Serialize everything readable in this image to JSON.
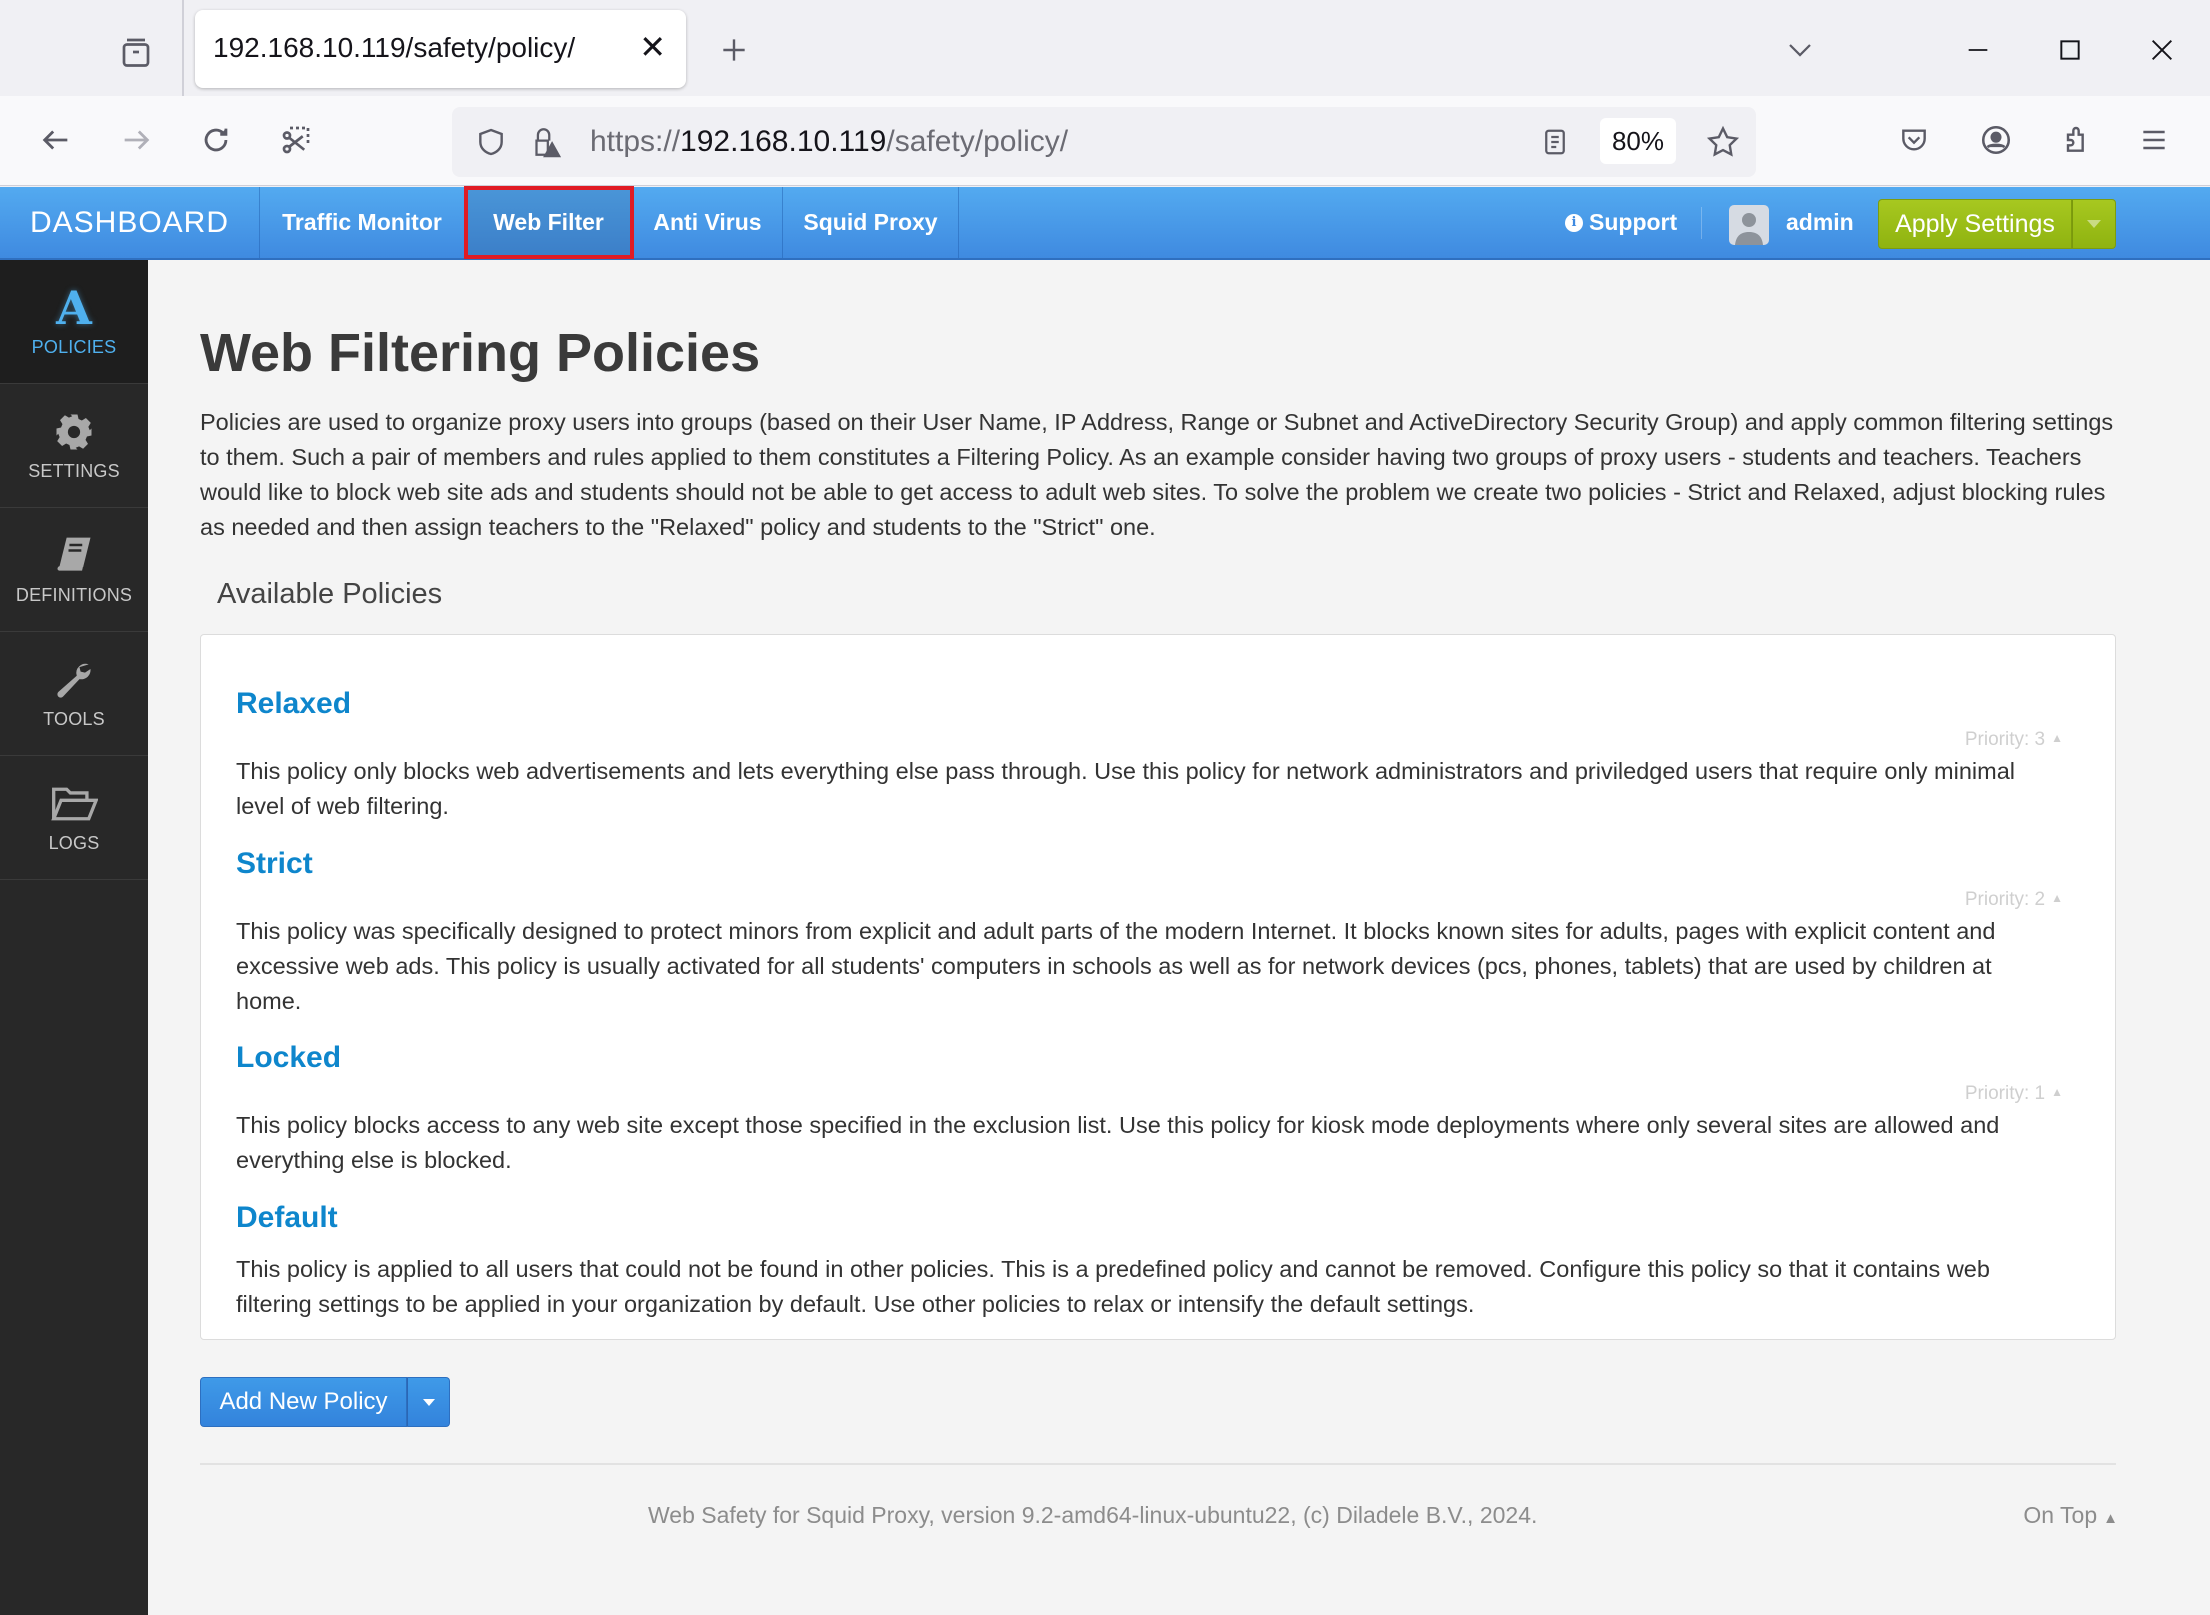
{
  "browser": {
    "tab_title": "192.168.10.119/safety/policy/",
    "url_scheme": "https://",
    "url_host": "192.168.10.119",
    "url_path": "/safety/policy/",
    "zoom_level": "80%",
    "icons": {
      "tab_overview": "tab-overview-icon",
      "close_tab": "close-icon",
      "new_tab": "plus-icon",
      "list_all_tabs": "chevron-down-icon",
      "minimize": "minimize-icon",
      "maximize": "maximize-icon",
      "close_window": "close-icon",
      "back": "arrow-left-icon",
      "forward": "arrow-right-icon",
      "reload": "reload-icon",
      "screenshot": "screenshot-icon",
      "shield": "shield-icon",
      "insecure_lock": "lock-warning-icon",
      "reader_view": "reader-view-icon",
      "bookmark": "star-icon",
      "pocket": "pocket-icon",
      "account": "account-icon",
      "extensions": "puzzle-icon",
      "menu": "hamburger-icon"
    }
  },
  "appnav": {
    "brand": "DASHBOARD",
    "items": [
      {
        "label": "Traffic Monitor",
        "active": false
      },
      {
        "label": "Web Filter",
        "active": true
      },
      {
        "label": "Anti Virus",
        "active": false
      },
      {
        "label": "Squid Proxy",
        "active": false
      }
    ],
    "support_label": "Support",
    "username": "admin",
    "apply_label": "Apply Settings"
  },
  "sidebar": {
    "items": [
      {
        "label": "POLICIES",
        "icon": "letter-a-icon",
        "active": true
      },
      {
        "label": "SETTINGS",
        "icon": "gear-icon",
        "active": false
      },
      {
        "label": "DEFINITIONS",
        "icon": "book-icon",
        "active": false
      },
      {
        "label": "TOOLS",
        "icon": "wrench-icon",
        "active": false
      },
      {
        "label": "LOGS",
        "icon": "folder-open-icon",
        "active": false
      }
    ]
  },
  "page": {
    "title": "Web Filtering Policies",
    "intro": "Policies are used to organize proxy users into groups (based on their User Name, IP Address, Range or Subnet and ActiveDirectory Security Group) and apply common filtering settings to them. Such a pair of members and rules applied to them constitutes a Filtering Policy. As an example consider having two groups of proxy users - students and teachers. Teachers would like to block web site ads and students should not be able to get access to adult web sites. To solve the problem we create two policies - Strict and Relaxed, adjust blocking rules as needed and then assign teachers to the \"Relaxed\" policy and students to the \"Strict\" one.",
    "available_label": "Available Policies",
    "policies": [
      {
        "name": "Relaxed",
        "priority": "Priority: 3",
        "description": "This policy only blocks web advertisements and lets everything else pass through. Use this policy for network administrators and priviledged users that require only minimal level of web filtering."
      },
      {
        "name": "Strict",
        "priority": "Priority: 2",
        "description": "This policy was specifically designed to protect minors from explicit and adult parts of the modern Internet. It blocks known sites for adults, pages with explicit content and excessive web ads. This policy is usually activated for all students' computers in schools as well as for network devices (pcs, phones, tablets) that are used by children at home."
      },
      {
        "name": "Locked",
        "priority": "Priority: 1",
        "description": "This policy blocks access to any web site except those specified in the exclusion list. Use this policy for kiosk mode deployments where only several sites are allowed and everything else is blocked."
      },
      {
        "name": "Default",
        "priority": "",
        "description": "This policy is applied to all users that could not be found in other policies. This is a predefined policy and cannot be removed. Configure this policy so that it contains web filtering settings to be applied in your organization by default. Use other policies to relax or intensify the default settings."
      }
    ],
    "add_button_label": "Add New Policy"
  },
  "footer": {
    "text": "Web Safety for Squid Proxy, version 9.2-amd64-linux-ubuntu22, (c) Diladele B.V., 2024.",
    "on_top_label": "On Top"
  },
  "colors": {
    "nav_blue": "#4a9ae8",
    "apply_green": "#9bbd18",
    "policy_link": "#0e86cc",
    "sidebar_bg": "#282828",
    "sidebar_active": "#4fb0ee",
    "highlight_red": "#e01b24"
  }
}
